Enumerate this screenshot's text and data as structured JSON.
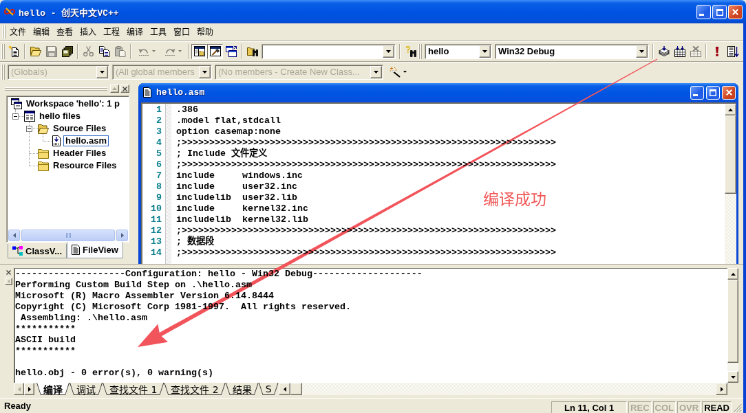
{
  "window": {
    "title": "hello - 创天中文VC++"
  },
  "menu": [
    "文件",
    "编辑",
    "查看",
    "插入",
    "工程",
    "编译",
    "工具",
    "窗口",
    "帮助"
  ],
  "toolbar_rows": [
    [
      {
        "groups": [
          [
            {
              "kind": "new",
              "disabled": false,
              "pressed": false
            }
          ],
          [
            {
              "kind": "open",
              "disabled": false,
              "pressed": false
            },
            {
              "kind": "save",
              "disabled": true,
              "pressed": false
            },
            {
              "kind": "save_all",
              "disabled": false,
              "pressed": false
            }
          ],
          [
            {
              "kind": "cut",
              "disabled": true,
              "pressed": false
            },
            {
              "kind": "copy",
              "disabled": false,
              "pressed": false
            },
            {
              "kind": "paste",
              "disabled": true,
              "pressed": false
            }
          ],
          [
            {
              "kind": "undo",
              "disabled": true,
              "pressed": false
            },
            {
              "kind": "redo",
              "disabled": true,
              "pressed": false
            }
          ],
          [
            {
              "kind": "workspace",
              "disabled": false,
              "pressed": true
            },
            {
              "kind": "output",
              "disabled": false,
              "pressed": true
            },
            {
              "kind": "windows",
              "disabled": false,
              "pressed": false
            }
          ],
          [
            {
              "kind": "find_in_files",
              "disabled": false,
              "pressed": false
            },
            {
              "kind": "combo",
              "disabled": false
            }
          ],
          [
            {
              "kind": "search",
              "disabled": false,
              "pressed": false
            }
          ]
        ]
      },
      {
        "groups": [
          [
            {
              "kind": "combo",
              "value": "hello",
              "disabled": false
            },
            {
              "kind": "combo",
              "value": "Win32 Debug",
              "disabled": false
            }
          ],
          [
            {
              "kind": "compile",
              "disabled": false,
              "pressed": false
            },
            {
              "kind": "build",
              "disabled": false,
              "pressed": false
            },
            {
              "kind": "stop",
              "disabled": true,
              "pressed": false
            }
          ],
          [
            {
              "kind": "execute",
              "disabled": false,
              "pressed": false
            },
            {
              "kind": "breakpoint",
              "disabled": false,
              "pressed": false
            }
          ]
        ]
      }
    ],
    [
      {
        "groups": [
          [
            {
              "kind": "combo",
              "value": "(Globals)",
              "disabled": true
            },
            {
              "kind": "combo",
              "value": "(All global members",
              "disabled": true
            },
            {
              "kind": "combo",
              "value": "(No members - Create New Class...",
              "disabled": true
            },
            {
              "kind": "wizard",
              "disabled": false,
              "pressed": false
            }
          ]
        ]
      }
    ]
  ],
  "workspace": {
    "tree": [
      {
        "kind": "workspace",
        "label": "Workspace 'hello': 1 p",
        "selected": false,
        "children": [
          {
            "kind": "project",
            "label": "hello files",
            "selected": false,
            "expanded": true,
            "children": [
              {
                "kind": "folder",
                "label": "Source Files",
                "selected": false,
                "expanded": true,
                "children": [
                  {
                    "kind": "file",
                    "label": "hello.asm",
                    "selected": true
                  }
                ]
              },
              {
                "kind": "folder",
                "label": "Header Files",
                "selected": false
              },
              {
                "kind": "folder",
                "label": "Resource Files",
                "selected": false
              }
            ]
          }
        ]
      }
    ],
    "tabs": [
      {
        "label": "ClassV...",
        "selected": false
      },
      {
        "label": "FileView",
        "selected": true
      }
    ]
  },
  "editor": {
    "title": "hello.asm",
    "lines": [
      {
        "number": "1",
        "text": ".386"
      },
      {
        "number": "2",
        "text": ".model flat,stdcall"
      },
      {
        "number": "3",
        "text": "option casemap:none"
      },
      {
        "number": "4",
        "text": ";>>>>>>>>>>>>>>>>>>>>>>>>>>>>>>>>>>>>>>>>>>>>>>>>>>>>>>>>>>>>>>>>>>>>"
      },
      {
        "number": "5",
        "text": "; Include 文件定义"
      },
      {
        "number": "6",
        "text": ";>>>>>>>>>>>>>>>>>>>>>>>>>>>>>>>>>>>>>>>>>>>>>>>>>>>>>>>>>>>>>>>>>>>>"
      },
      {
        "number": "7",
        "text": "include     windows.inc"
      },
      {
        "number": "8",
        "text": "include     user32.inc"
      },
      {
        "number": "9",
        "text": "includelib  user32.lib"
      },
      {
        "number": "10",
        "text": "include     kernel32.inc"
      },
      {
        "number": "11",
        "text": "includelib  kernel32.lib"
      },
      {
        "number": "12",
        "text": ";>>>>>>>>>>>>>>>>>>>>>>>>>>>>>>>>>>>>>>>>>>>>>>>>>>>>>>>>>>>>>>>>>>>>"
      },
      {
        "number": "13",
        "text": "; 数据段"
      },
      {
        "number": "14",
        "text": ";>>>>>>>>>>>>>>>>>>>>>>>>>>>>>>>>>>>>>>>>>>>>>>>>>>>>>>>>>>>>>>>>>>>>"
      }
    ]
  },
  "output": {
    "blocks": [
      [
        "--------------------Configuration: hello - Win32 Debug--------------------",
        "Performing Custom Build Step on .\\hello.asm",
        "Microsoft (R) Macro Assembler Version 6.14.8444",
        "Copyright (C) Microsoft Corp 1981-1997.  All rights reserved.",
        " Assembling: .\\hello.asm",
        "***********",
        "ASCII build",
        "***********"
      ],
      [
        "hello.obj - 0 error(s), 0 warning(s)"
      ]
    ],
    "tabs": [
      {
        "label": "编译",
        "selected": true
      },
      {
        "label": "调试",
        "selected": false
      },
      {
        "label": "查找文件 1",
        "selected": false
      },
      {
        "label": "查找文件 2",
        "selected": false
      },
      {
        "label": "结果",
        "selected": false
      },
      {
        "label": "S",
        "selected": false
      }
    ]
  },
  "status_bar": {
    "message": "Ready",
    "position": "Ln 11, Col 1",
    "indicators": [
      {
        "label": "REC",
        "active": false
      },
      {
        "label": "COL",
        "active": false
      },
      {
        "label": "OVR",
        "active": false
      },
      {
        "label": "READ",
        "active": true
      }
    ]
  },
  "annotation": {
    "text": "编译成功"
  }
}
